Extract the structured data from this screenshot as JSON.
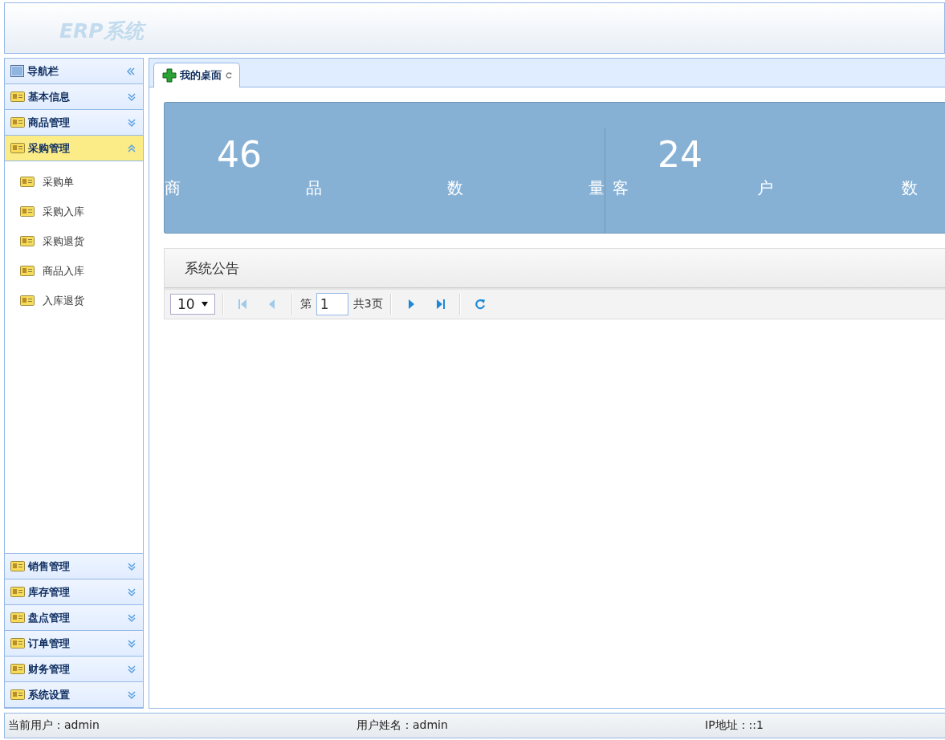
{
  "header": {
    "logo": "ERP系统"
  },
  "sidebar": {
    "title": "导航栏",
    "sections": [
      {
        "label": "基本信息",
        "expanded": false
      },
      {
        "label": "商品管理",
        "expanded": false
      },
      {
        "label": "采购管理",
        "expanded": true,
        "items": [
          "采购单",
          "采购入库",
          "采购退货",
          "商品入库",
          "入库退货"
        ]
      },
      {
        "label": "销售管理",
        "expanded": false
      },
      {
        "label": "库存管理",
        "expanded": false
      },
      {
        "label": "盘点管理",
        "expanded": false
      },
      {
        "label": "订单管理",
        "expanded": false
      },
      {
        "label": "财务管理",
        "expanded": false
      },
      {
        "label": "系统设置",
        "expanded": false
      }
    ]
  },
  "tabs": [
    {
      "label": "我的桌面",
      "selected": true
    }
  ],
  "stats": [
    {
      "value": "46",
      "label": "商品数量"
    },
    {
      "value": "24",
      "label": "客户数"
    }
  ],
  "notice": {
    "title": "系统公告",
    "pager": {
      "page_size": "10",
      "page_label": "第",
      "page": "1",
      "total": "共3页",
      "buttons": [
        {
          "kind": "first",
          "disabled": true
        },
        {
          "kind": "prev",
          "disabled": true
        },
        {
          "kind": "next",
          "disabled": false
        },
        {
          "kind": "last",
          "disabled": false
        },
        {
          "kind": "refresh",
          "disabled": false
        }
      ]
    }
  },
  "status_bar": [
    "当前用户：admin",
    "用户姓名：admin",
    "IP地址：::1"
  ]
}
